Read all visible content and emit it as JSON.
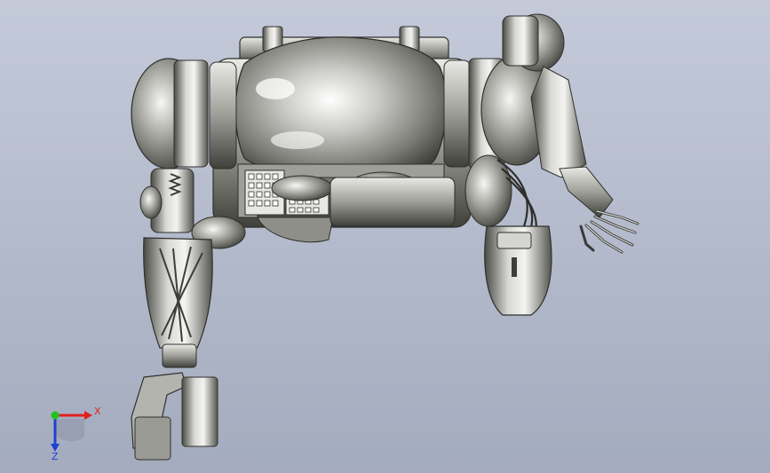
{
  "viewport": {
    "background_top": "#c4cad9",
    "background_bottom": "#a3abbe"
  },
  "triad": {
    "x_label": "X",
    "z_label": "Z",
    "x_color": "#e02020",
    "y_color": "#20c020",
    "z_color": "#2040d0"
  },
  "model": {
    "metal_light": "#f2f2f0",
    "metal_mid": "#a9aaa3",
    "metal_dark": "#3d3d39"
  }
}
